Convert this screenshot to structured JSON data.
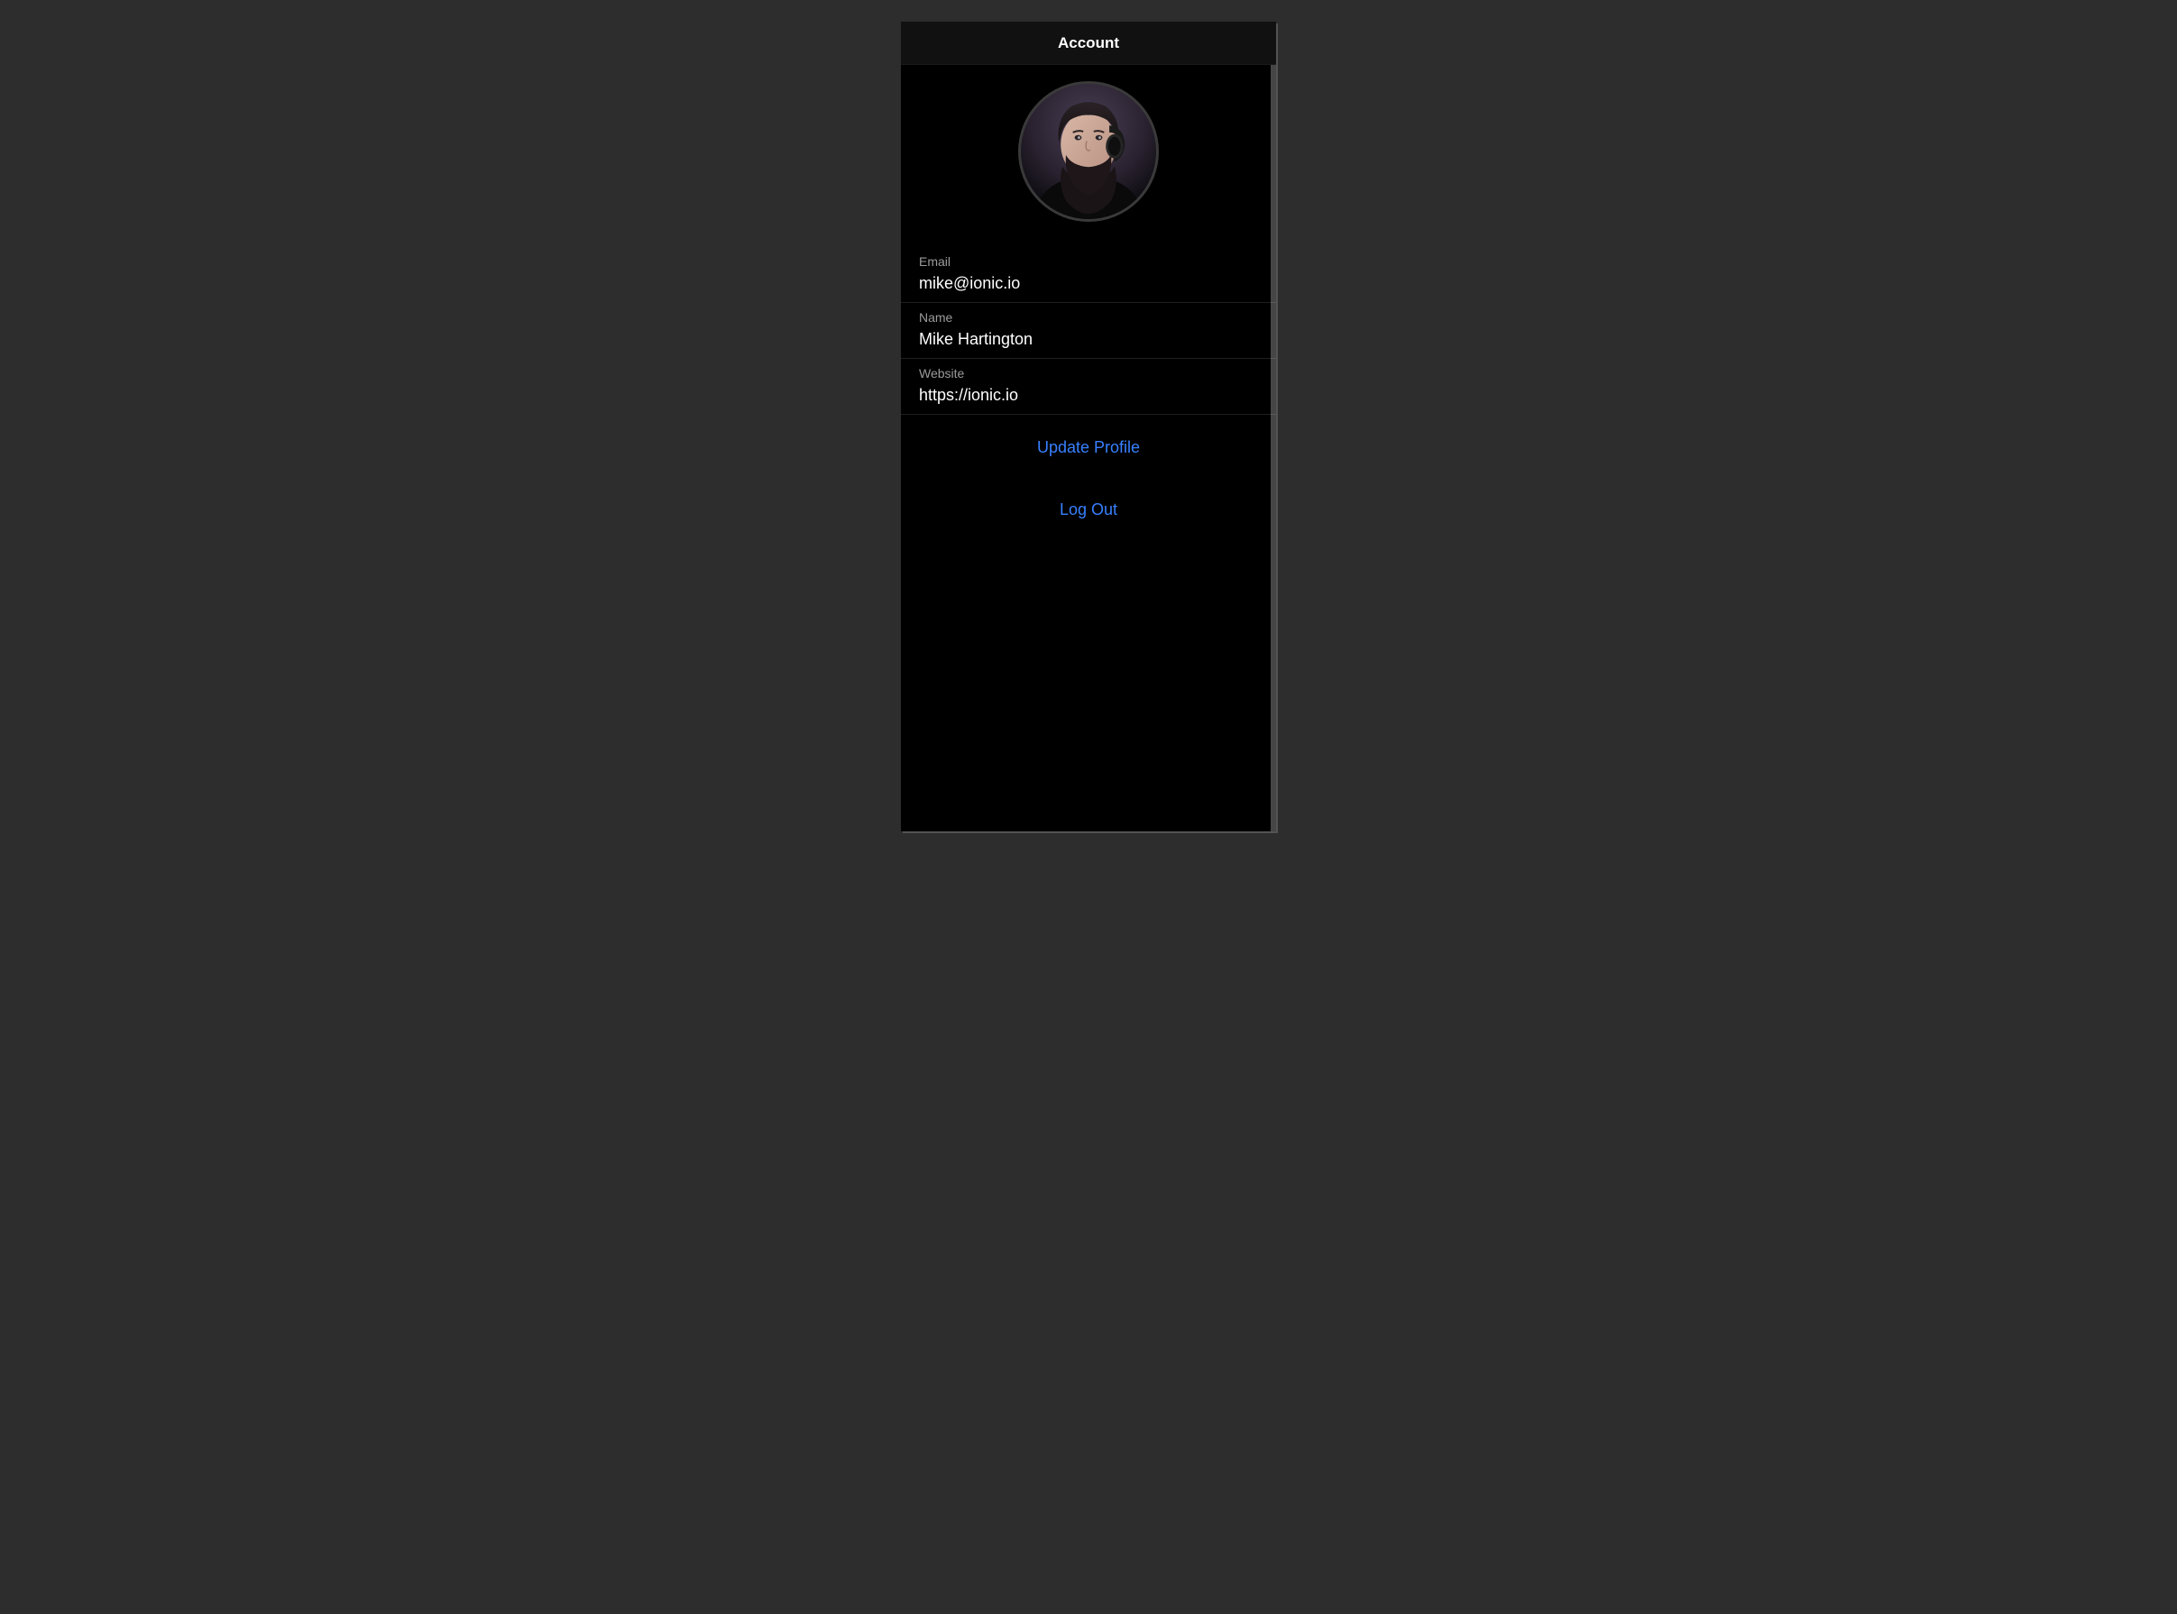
{
  "header": {
    "title": "Account"
  },
  "profile": {
    "avatar_alt": "user-avatar"
  },
  "fields": {
    "email": {
      "label": "Email",
      "value": "mike@ionic.io"
    },
    "name": {
      "label": "Name",
      "value": "Mike Hartington"
    },
    "website": {
      "label": "Website",
      "value": "https://ionic.io"
    }
  },
  "buttons": {
    "update_profile": "Update Profile",
    "log_out": "Log Out"
  },
  "colors": {
    "accent": "#3880ff",
    "background": "#000000",
    "page_background": "#2d2d2d",
    "header_background": "#111111",
    "text_primary": "#ffffff",
    "text_secondary": "#9b9b9b",
    "divider": "#1f1f1f"
  }
}
